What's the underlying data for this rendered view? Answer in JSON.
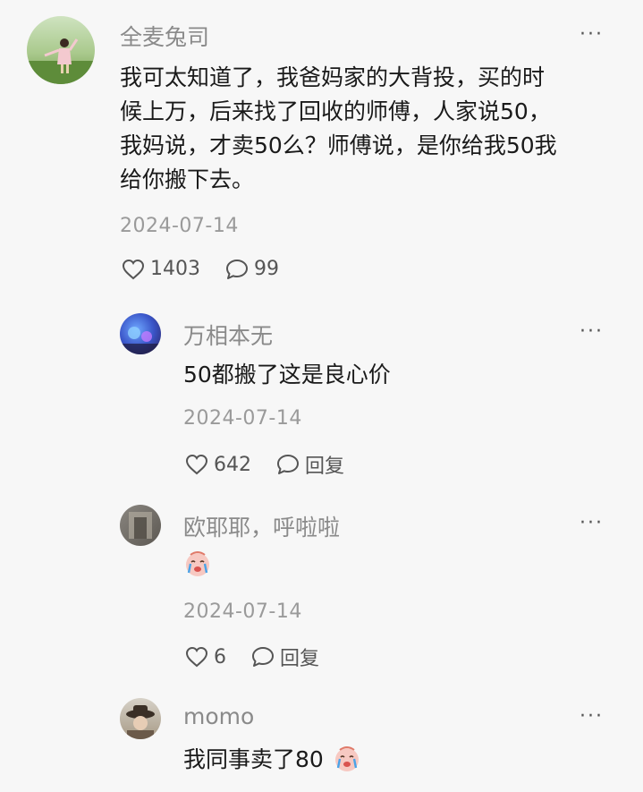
{
  "comments": [
    {
      "username": "全麦兔司",
      "text_lines": [
        "我可太知道了，我爸妈家的大背投，买的时",
        "候上万，后来找了回收的师傅，人家说50，",
        "我妈说，才卖50么？师傅说，是你给我50我",
        "给你搬下去。"
      ],
      "date": "2024-07-14",
      "likes": "1403",
      "replies": "99",
      "more": "···",
      "avatar_icon": "girl-in-field-avatar"
    },
    {
      "username": "万相本无",
      "text": "50都搬了这是良心价",
      "date": "2024-07-14",
      "likes": "642",
      "reply_label": "回复",
      "more": "···",
      "avatar_icon": "blue-concert-avatar"
    },
    {
      "username": "欧耶耶，呼啦啦",
      "emoji": "crying-face-emoji",
      "date": "2024-07-14",
      "likes": "6",
      "reply_label": "回复",
      "more": "···",
      "avatar_icon": "grey-photo-avatar"
    },
    {
      "username": "momo",
      "text": "我同事卖了80",
      "emoji": "crying-face-emoji",
      "more": "···",
      "avatar_icon": "hat-person-avatar"
    }
  ],
  "colors": {
    "background": "#f7f7f7",
    "username": "#8a8a8a",
    "text": "#1a1a1a",
    "meta": "#9a9a9a"
  }
}
